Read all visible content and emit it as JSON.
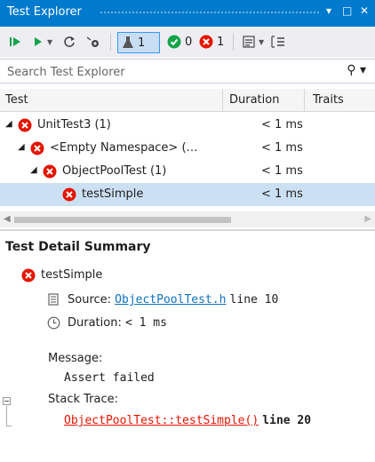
{
  "window": {
    "title": "Test Explorer",
    "buttons": [
      "▾",
      "□",
      "✕"
    ]
  },
  "toolbar": {
    "run_all_icon": "run-all-icon",
    "run_icon": "run-icon",
    "refresh_icon": "refresh-icon",
    "clear_icon": "clear-icon",
    "total_count": "1",
    "passed_count": "0",
    "failed_count": "1",
    "playlist_icon": "playlist-icon",
    "group_icon": "group-by-icon"
  },
  "search": {
    "placeholder": "Search Test Explorer",
    "icon": "search-icon"
  },
  "columns": {
    "test": "Test",
    "duration": "Duration",
    "traits": "Traits"
  },
  "tree": [
    {
      "name": "UnitTest3 (1)",
      "duration": "< 1 ms"
    },
    {
      "name": "<Empty Namespace> (…",
      "duration": "< 1 ms"
    },
    {
      "name": "ObjectPoolTest (1)",
      "duration": "< 1 ms"
    },
    {
      "name": "testSimple",
      "duration": "< 1 ms"
    }
  ],
  "detail": {
    "title": "Test Detail Summary",
    "test_name": "testSimple",
    "source_label": "Source:",
    "source_file": "ObjectPoolTest.h",
    "source_line": "line 10",
    "duration_label": "Duration:",
    "duration_value": "< 1 ms",
    "message_label": "Message:",
    "message_text": "Assert failed",
    "stack_label": "Stack Trace:",
    "stack_frame": "ObjectPoolTest::testSimple()",
    "stack_line": "line 20"
  },
  "colors": {
    "accent": "#007acc",
    "fail": "#e51400",
    "pass": "#16a34a",
    "selection": "#cce0f4",
    "link": "#0e70c0"
  }
}
